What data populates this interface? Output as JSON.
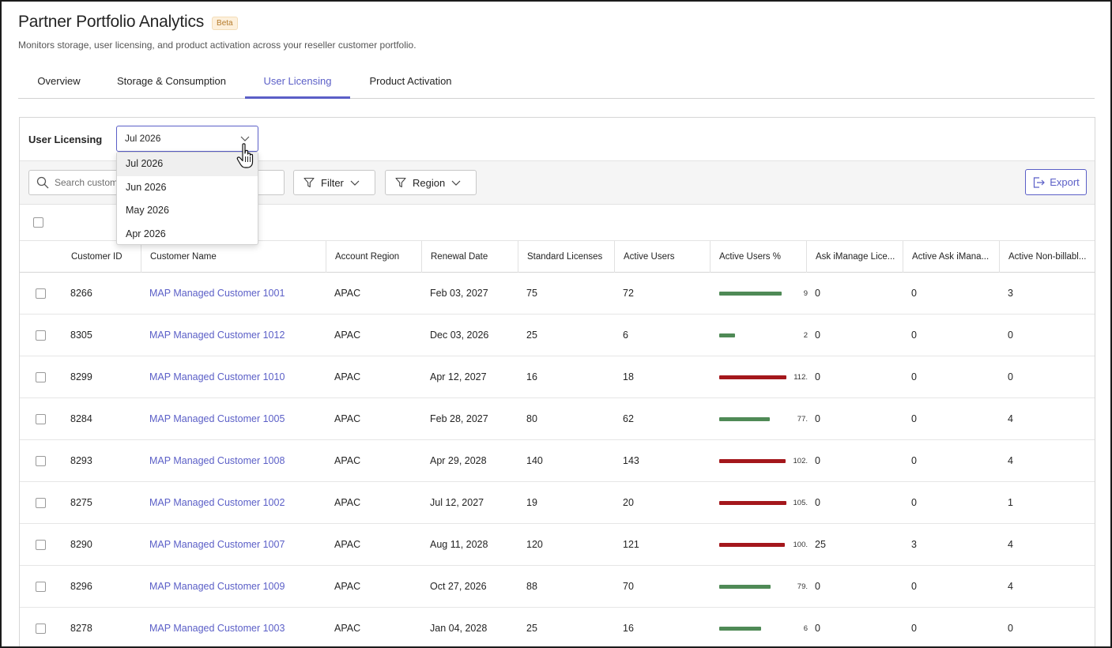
{
  "header": {
    "title": "Partner Portfolio Analytics",
    "badge": "Beta",
    "subtitle": "Monitors storage, user licensing, and product activation across your reseller customer portfolio."
  },
  "tabs": [
    {
      "label": "Overview",
      "active": false
    },
    {
      "label": "Storage & Consumption",
      "active": false
    },
    {
      "label": "User Licensing",
      "active": true
    },
    {
      "label": "Product Activation",
      "active": false
    }
  ],
  "licensing": {
    "label": "User Licensing",
    "selected_month": "Jul 2026",
    "options": [
      "Jul 2026",
      "Jun 2026",
      "May 2026",
      "Apr 2026"
    ]
  },
  "toolbar": {
    "search_placeholder": "Search customers",
    "filter_label": "Filter",
    "region_label": "Region",
    "export_label": "Export"
  },
  "table": {
    "columns": [
      "Customer ID",
      "Customer Name",
      "Account Region",
      "Renewal Date",
      "Standard Licenses",
      "Active Users",
      "Active Users %",
      "Ask iManage Lice...",
      "Active Ask iMana...",
      "Active Non-billabl..."
    ],
    "rows": [
      {
        "id": "8266",
        "name": "MAP Managed Customer 1001",
        "region": "APAC",
        "renewal": "Feb 03, 2027",
        "licenses": "75",
        "active": "72",
        "pct": 96,
        "pct_label": "9",
        "ask_lic": "0",
        "ask_active": "0",
        "non_billable": "3"
      },
      {
        "id": "8305",
        "name": "MAP Managed Customer 1012",
        "region": "APAC",
        "renewal": "Dec 03, 2026",
        "licenses": "25",
        "active": "6",
        "pct": 24,
        "pct_label": "2",
        "ask_lic": "0",
        "ask_active": "0",
        "non_billable": "0"
      },
      {
        "id": "8299",
        "name": "MAP Managed Customer 1010",
        "region": "APAC",
        "renewal": "Apr 12, 2027",
        "licenses": "16",
        "active": "18",
        "pct": 112.5,
        "pct_label": "112.",
        "ask_lic": "0",
        "ask_active": "0",
        "non_billable": "0"
      },
      {
        "id": "8284",
        "name": "MAP Managed Customer 1005",
        "region": "APAC",
        "renewal": "Feb 28, 2027",
        "licenses": "80",
        "active": "62",
        "pct": 77.5,
        "pct_label": "77.",
        "ask_lic": "0",
        "ask_active": "0",
        "non_billable": "4"
      },
      {
        "id": "8293",
        "name": "MAP Managed Customer 1008",
        "region": "APAC",
        "renewal": "Apr 29, 2028",
        "licenses": "140",
        "active": "143",
        "pct": 102.1,
        "pct_label": "102.",
        "ask_lic": "0",
        "ask_active": "0",
        "non_billable": "4"
      },
      {
        "id": "8275",
        "name": "MAP Managed Customer 1002",
        "region": "APAC",
        "renewal": "Jul 12, 2027",
        "licenses": "19",
        "active": "20",
        "pct": 105.3,
        "pct_label": "105.",
        "ask_lic": "0",
        "ask_active": "0",
        "non_billable": "1"
      },
      {
        "id": "8290",
        "name": "MAP Managed Customer 1007",
        "region": "APAC",
        "renewal": "Aug 11, 2028",
        "licenses": "120",
        "active": "121",
        "pct": 100.8,
        "pct_label": "100.",
        "ask_lic": "25",
        "ask_active": "3",
        "non_billable": "4"
      },
      {
        "id": "8296",
        "name": "MAP Managed Customer 1009",
        "region": "APAC",
        "renewal": "Oct 27, 2026",
        "licenses": "88",
        "active": "70",
        "pct": 79.5,
        "pct_label": "79.",
        "ask_lic": "0",
        "ask_active": "0",
        "non_billable": "4"
      },
      {
        "id": "8278",
        "name": "MAP Managed Customer 1003",
        "region": "APAC",
        "renewal": "Jan 04, 2028",
        "licenses": "25",
        "active": "16",
        "pct": 64,
        "pct_label": "6",
        "ask_lic": "0",
        "ask_active": "0",
        "non_billable": "0"
      }
    ]
  },
  "colors": {
    "accent": "#5b5fc7",
    "bar_ok": "#4f8a56",
    "bar_over": "#a4171c"
  }
}
